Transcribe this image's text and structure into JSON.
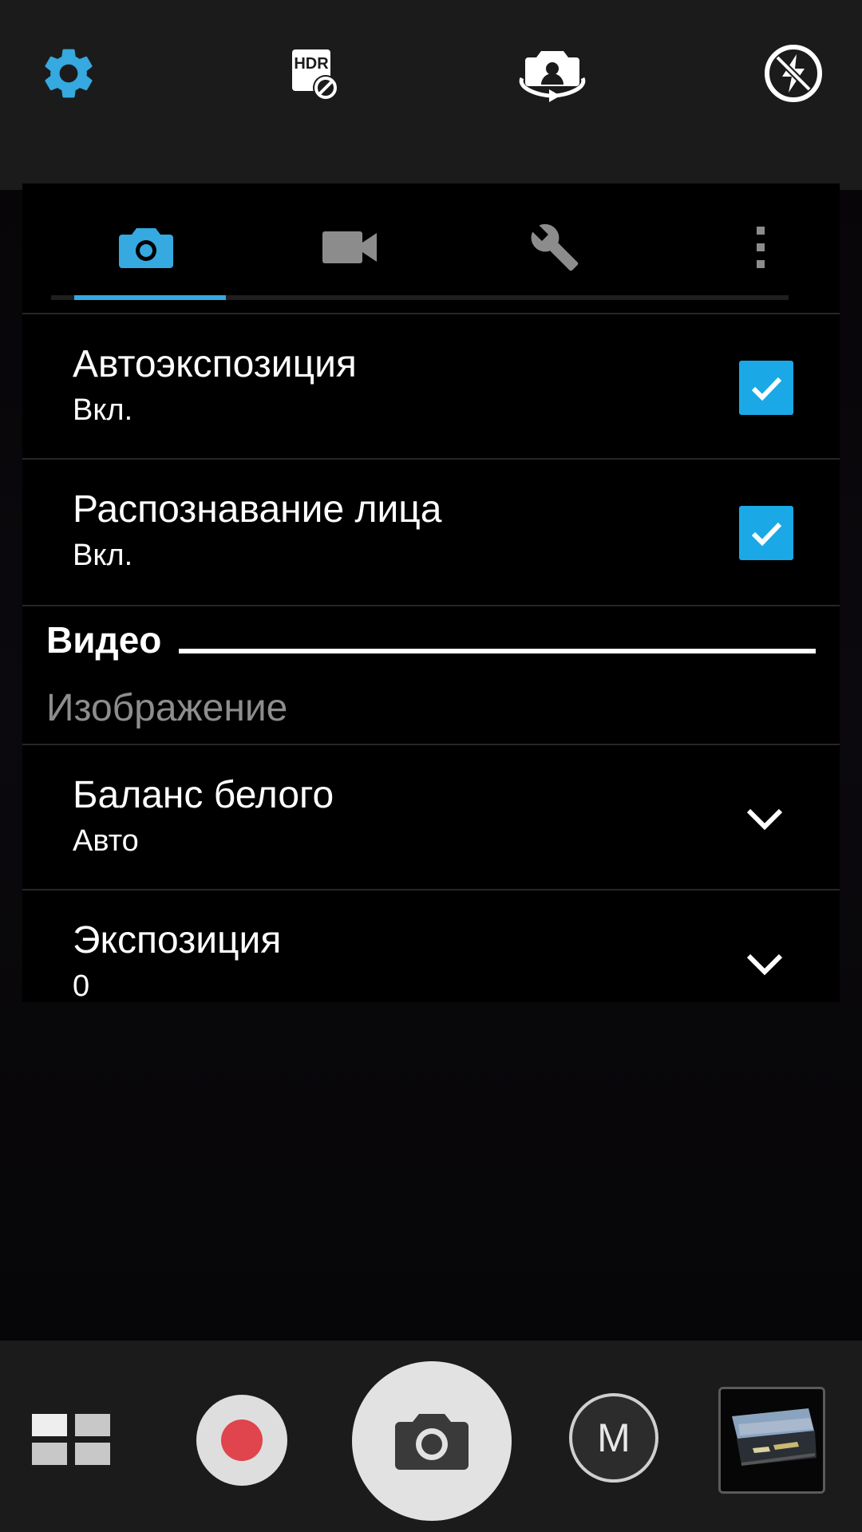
{
  "top_bar": {
    "icons": [
      "gear-icon",
      "hdr-off-icon",
      "switch-camera-icon",
      "flash-off-icon"
    ],
    "accent_color": "#35a9e0"
  },
  "tabs": {
    "items": [
      "camera-icon",
      "video-camera-icon",
      "wrench-icon",
      "more-vertical-icon"
    ],
    "selected": 0
  },
  "settings": {
    "auto_exposure": {
      "title": "Автоэкспозиция",
      "value": "Вкл.",
      "checked": true
    },
    "face_detection": {
      "title": "Распознавание лица",
      "value": "Вкл.",
      "checked": true
    }
  },
  "section": {
    "header": "Видео",
    "subheader": "Изображение"
  },
  "image_settings": {
    "white_balance": {
      "title": "Баланс белого",
      "value": "Авто"
    },
    "exposure": {
      "title": "Экспозиция",
      "value": "0"
    }
  },
  "bottom_bar": {
    "manual_label": "M",
    "record_color": "#e0444c"
  }
}
